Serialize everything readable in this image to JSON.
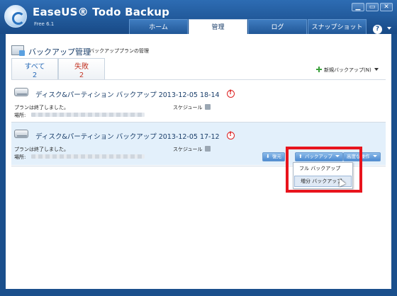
{
  "app": {
    "title": "EaseUS® Todo Backup",
    "edition": "Free 6.1"
  },
  "window_controls": {
    "minimize": "▁",
    "restore": "▭",
    "close": "✕"
  },
  "tabs": [
    {
      "label": "ホーム"
    },
    {
      "label": "管理",
      "active": true
    },
    {
      "label": "ログ"
    },
    {
      "label": "スナップショット"
    }
  ],
  "help": {
    "label": "?"
  },
  "page": {
    "title": "バックアップ管理",
    "subtitle": "バックアッププランの管理"
  },
  "filters": [
    {
      "label": "すべて",
      "count": "2"
    },
    {
      "label": "失敗",
      "count": "2"
    }
  ],
  "new_backup": {
    "label": "新規バックアップ(N)"
  },
  "jobs": [
    {
      "title": "ディスク&パーティション バックアップ 2013-12-05 18-14",
      "status": "プランは終了しました。",
      "location_label": "場所:",
      "schedule_label": "スケジュール"
    },
    {
      "title": "ディスク&パーティション バックアップ 2013-12-05 17-12",
      "status": "プランは終了しました。",
      "location_label": "場所:",
      "schedule_label": "スケジュール"
    }
  ],
  "actions": {
    "restore": "復元",
    "backup": "バックアップ",
    "advanced": "高度な操作"
  },
  "backup_menu": [
    {
      "label": "フル バックアップ"
    },
    {
      "label": "増分 バックアップ"
    }
  ],
  "colors": {
    "frame": "#1a4f8c",
    "accent": "#2b6cb8",
    "fail": "#c43a2a",
    "highlight": "#e8141d"
  }
}
